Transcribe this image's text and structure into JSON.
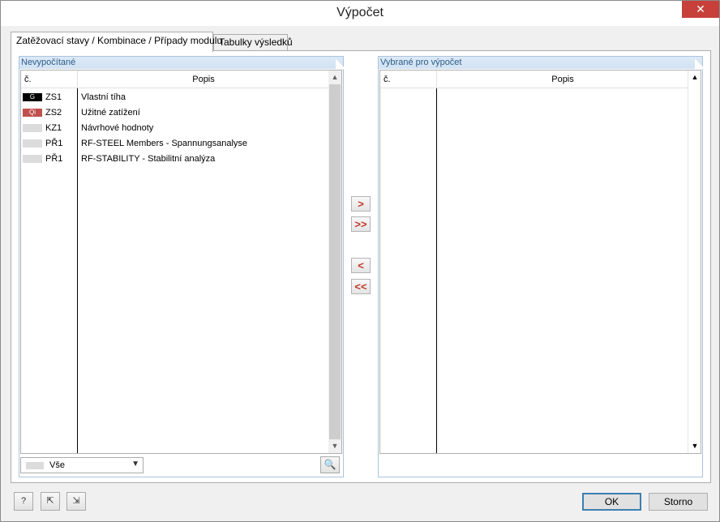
{
  "window": {
    "title": "Výpočet",
    "close_glyph": "✕"
  },
  "tabs": [
    {
      "label": "Zatěžovací stavy / Kombinace / Případy modulu",
      "active": true
    },
    {
      "label": "Tabulky výsledků",
      "active": false
    }
  ],
  "left_panel": {
    "title": "Nevypočítané",
    "columns": {
      "num": "č.",
      "desc": "Popis"
    },
    "rows": [
      {
        "badge": "G",
        "badge_color": "#000000",
        "code": "ZS1",
        "desc": "Vlastní tíha"
      },
      {
        "badge": "Qi",
        "badge_color": "#c0504d",
        "code": "ZS2",
        "desc": "Užitné zatížení"
      },
      {
        "badge": "",
        "badge_color": "#dcdcdc",
        "code": "KZ1",
        "desc": "Návrhové hodnoty"
      },
      {
        "badge": "",
        "badge_color": "#dcdcdc",
        "code": "PŘ1",
        "desc": "RF-STEEL Members - Spannungsanalyse"
      },
      {
        "badge": "",
        "badge_color": "#dcdcdc",
        "code": "PŘ1",
        "desc": "RF-STABILITY - Stabilitní analýza"
      }
    ],
    "filter": {
      "value": "Vše"
    }
  },
  "right_panel": {
    "title": "Vybrané pro výpočet",
    "columns": {
      "num": "č.",
      "desc": "Popis"
    },
    "rows": []
  },
  "move_buttons": {
    "add": ">",
    "add_all": ">>",
    "remove": "<",
    "remove_all": "<<"
  },
  "icons": {
    "scroll_up": "▲",
    "scroll_down": "▼",
    "combo_arrow": "▼",
    "filter_icon": "🔍",
    "help_icon": "?",
    "export_icon": "⇱",
    "import_icon": "⇲"
  },
  "buttons": {
    "ok": "OK",
    "cancel": "Storno"
  }
}
